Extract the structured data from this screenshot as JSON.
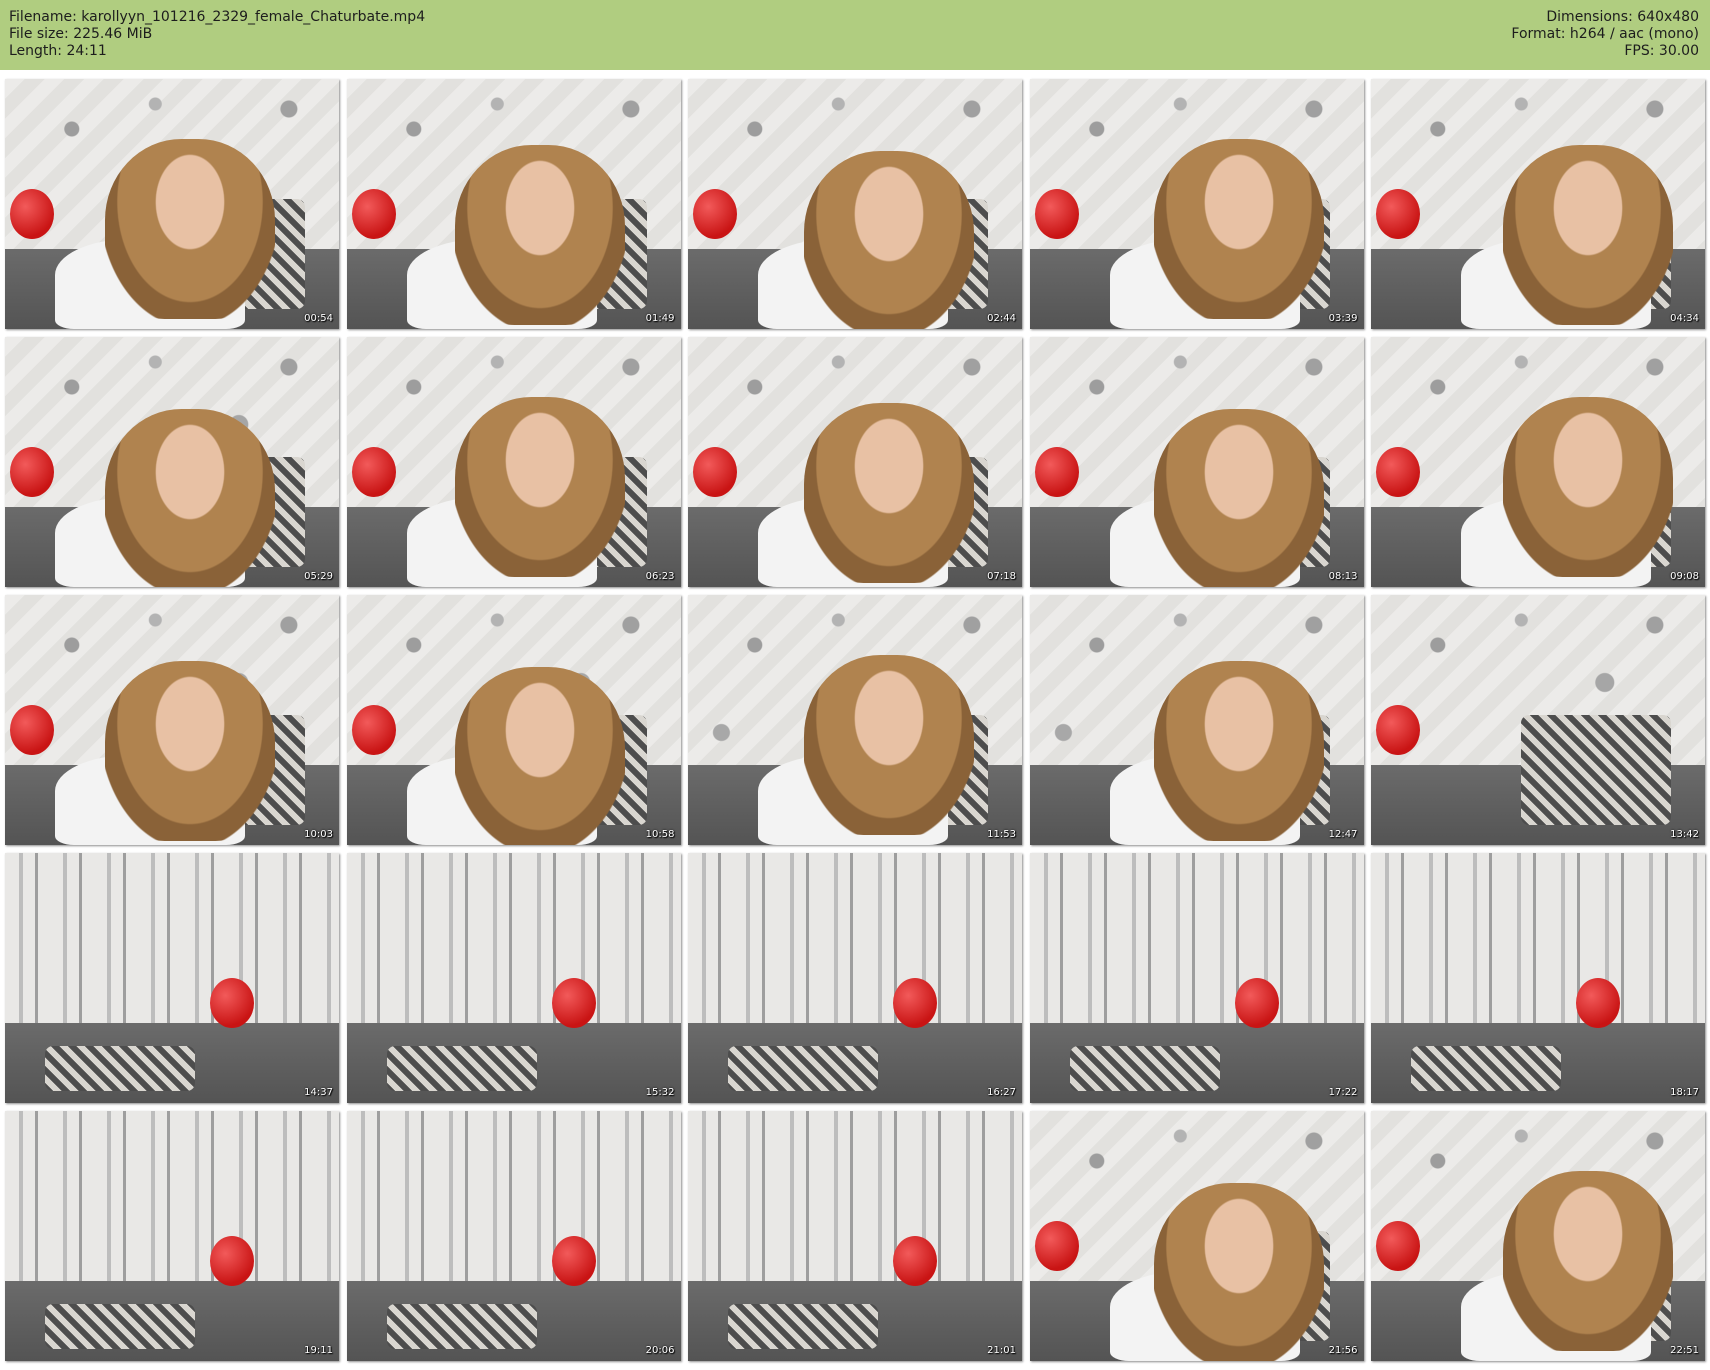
{
  "header": {
    "filename_line": "Filename: karollyyn_101216_2329_female_Chaturbate.mp4",
    "filesize_line": "File size: 225.46 MiB",
    "length_line": "Length: 24:11",
    "dimensions_line": "Dimensions: 640x480",
    "format_line": "Format: h264 / aac (mono)",
    "fps_line": "FPS: 30.00"
  },
  "colors": {
    "header_bg": "#b0cd80",
    "page_bg": "#ffffff"
  },
  "thumbnails": [
    {
      "timestamp": "00:54",
      "scene": "floral-wall girl lying on sofa"
    },
    {
      "timestamp": "01:49",
      "scene": "floral-wall girl lying on sofa"
    },
    {
      "timestamp": "02:44",
      "scene": "floral-wall girl close-up"
    },
    {
      "timestamp": "03:39",
      "scene": "floral-wall girl hand at mouth"
    },
    {
      "timestamp": "04:34",
      "scene": "floral-wall girl hand at mouth"
    },
    {
      "timestamp": "05:29",
      "scene": "floral-wall girl hand at mouth"
    },
    {
      "timestamp": "06:23",
      "scene": "floral-wall girl lying on sofa"
    },
    {
      "timestamp": "07:18",
      "scene": "floral-wall girl lying on sofa"
    },
    {
      "timestamp": "08:13",
      "scene": "floral-wall girl lying on sofa"
    },
    {
      "timestamp": "09:08",
      "scene": "floral-wall girl hand at mouth"
    },
    {
      "timestamp": "10:03",
      "scene": "floral-wall girl hand at mouth"
    },
    {
      "timestamp": "10:58",
      "scene": "floral-wall girl leaning in"
    },
    {
      "timestamp": "11:53",
      "scene": "floral-wall girl leaning in"
    },
    {
      "timestamp": "12:47",
      "scene": "floral-wall girl sitting"
    },
    {
      "timestamp": "13:42",
      "scene": "striped/floral wall empty sofa"
    },
    {
      "timestamp": "14:37",
      "scene": "floral wall empty sofa with cushion"
    },
    {
      "timestamp": "15:32",
      "scene": "striped wall empty sofa"
    },
    {
      "timestamp": "16:27",
      "scene": "striped wall empty sofa"
    },
    {
      "timestamp": "17:22",
      "scene": "striped wall empty sofa"
    },
    {
      "timestamp": "18:17",
      "scene": "striped wall empty sofa"
    },
    {
      "timestamp": "19:11",
      "scene": "striped wall empty sofa"
    },
    {
      "timestamp": "20:06",
      "scene": "striped wall empty sofa"
    },
    {
      "timestamp": "21:01",
      "scene": "striped wall empty sofa"
    },
    {
      "timestamp": "21:56",
      "scene": "floral-wall girl lying on sofa"
    },
    {
      "timestamp": "22:51",
      "scene": "floral-wall girl lying on sofa"
    }
  ]
}
